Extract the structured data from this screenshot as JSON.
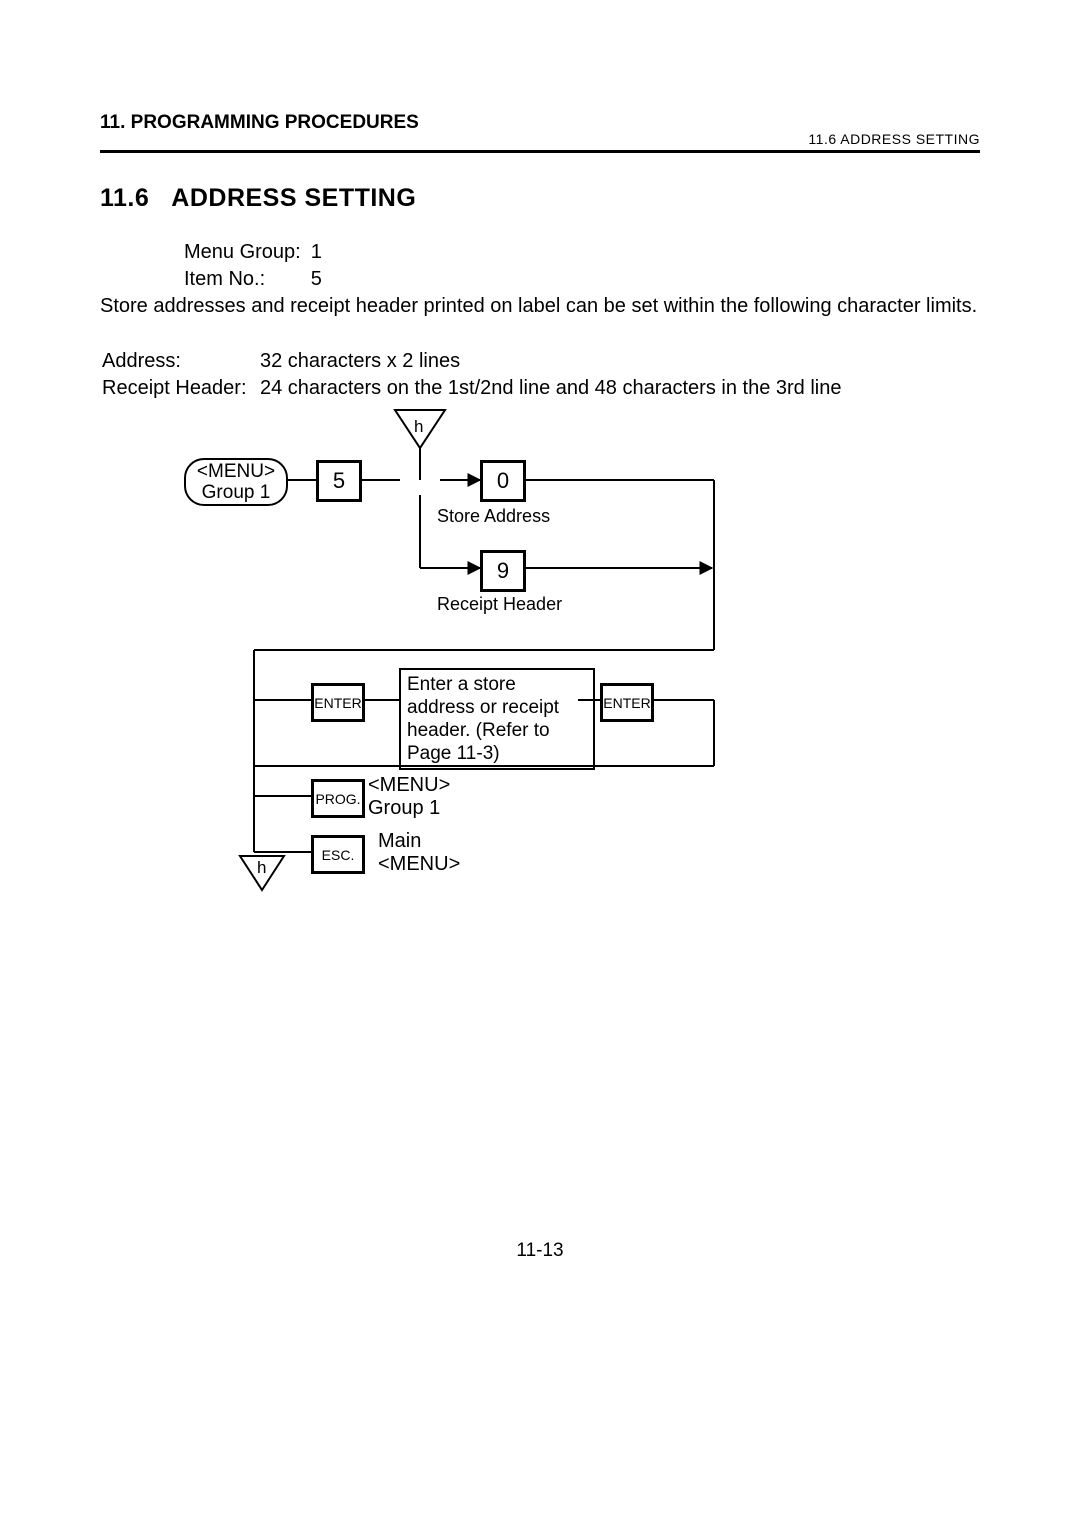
{
  "header": {
    "chapter": "11. PROGRAMMING PROCEDURES",
    "section_ref": "11.6 ADDRESS SETTING"
  },
  "section": {
    "number": "11.6",
    "title": "ADDRESS SETTING"
  },
  "meta": {
    "menu_group_label": "Menu Group:",
    "menu_group_value": "1",
    "item_no_label": "Item No.:",
    "item_no_value": "5"
  },
  "body": {
    "intro": "Store addresses and receipt header printed on label can be set within the following character limits.",
    "address_label": "Address:",
    "address_value": "32 characters x 2 lines",
    "receipt_label": "Receipt Header:",
    "receipt_value": "24 characters on the 1st/2nd line and 48 characters in the 3rd line"
  },
  "flow": {
    "tri_top": "h",
    "menu_box": "<MENU>\nGroup 1",
    "key_5": "5",
    "key_0": "0",
    "key_9": "9",
    "store_address": "Store Address",
    "receipt_header": "Receipt Header",
    "enter": "ENTER",
    "instruction": "Enter a store address or receipt header. (Refer to Page 11-3)",
    "prog": "PROG.",
    "prog_label": "<MENU>\nGroup 1",
    "esc": "ESC.",
    "esc_label": "Main\n<MENU>",
    "tri_bottom": "h"
  },
  "page_number": "11-13"
}
